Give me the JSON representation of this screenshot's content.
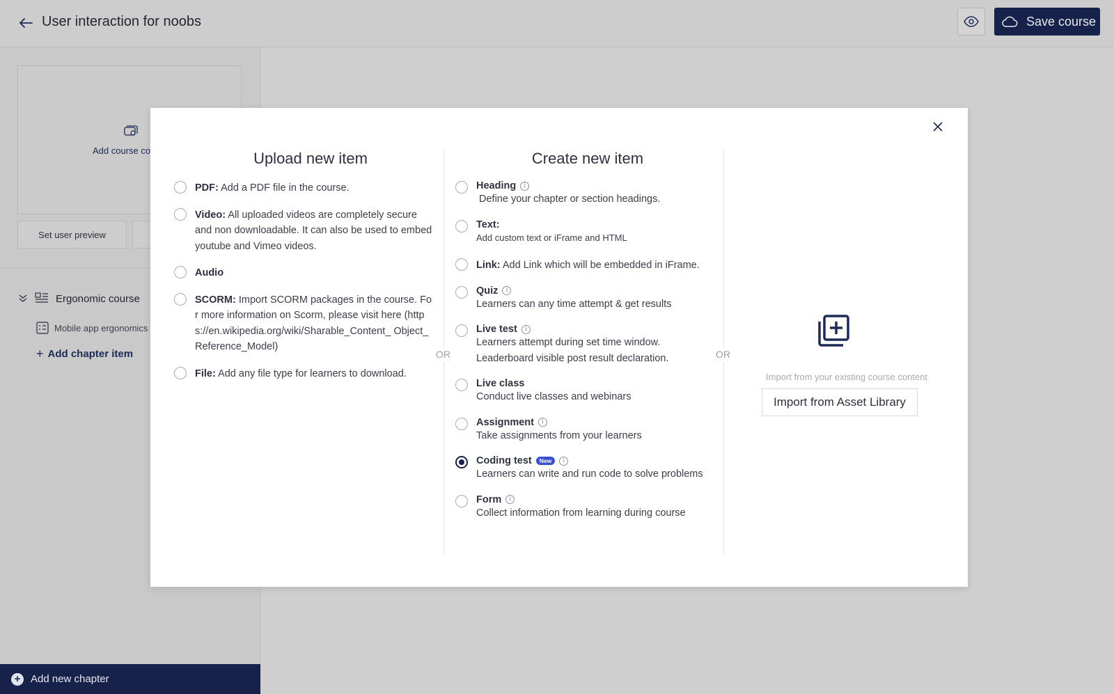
{
  "header": {
    "title": "User interaction for noobs",
    "save_label": "Save course",
    "icons": {
      "back": "arrow-left-icon",
      "preview": "eye-icon",
      "save": "cloud-icon"
    }
  },
  "sidebar": {
    "cover_label": "Add course co",
    "set_user_preview": "Set user preview",
    "chapter_title": "Ergonomic course",
    "chapter_item_label": "Mobile app ergonomics",
    "add_chapter_item": "Add chapter item",
    "add_new_chapter": "Add new chapter"
  },
  "modal": {
    "upload": {
      "title": "Upload new item",
      "options": [
        {
          "name": "PDF:",
          "desc": "Add a PDF file in the course."
        },
        {
          "name": "Video:",
          "desc": "All uploaded videos are completely secure and non downloadable. It can also be used to embed youtube and Vimeo videos."
        },
        {
          "name": "Audio",
          "desc": ""
        },
        {
          "name": "SCORM:",
          "desc": "Import SCORM packages in the course. For more information on Scorm, please visit here (https://en.wikipedia.org/wiki/Sharable_Content_ Object_Reference_Model)"
        },
        {
          "name": "File:",
          "desc": "Add any file type for learners to download."
        }
      ]
    },
    "or_label": "OR",
    "create": {
      "title": "Create new item",
      "options": [
        {
          "name": "Heading",
          "desc": "Define your chapter or section headings."
        },
        {
          "name": "Text:",
          "desc": "Add custom text or iFrame and HTML"
        },
        {
          "name": "Link:",
          "desc": "Add Link which will be embedded in iFrame."
        },
        {
          "name": "Quiz",
          "desc": "Learners can any time attempt & get results"
        },
        {
          "name": "Live test",
          "desc": "Learners attempt during set time window. Leaderboard visible post result declaration."
        },
        {
          "name": "Live class",
          "desc": "Conduct live classes and webinars"
        },
        {
          "name": "Assignment",
          "desc": "Take assignments from your learners"
        },
        {
          "name": "Coding test",
          "badge": "New",
          "desc": "Learners can write and run code to solve problems",
          "selected": true
        },
        {
          "name": "Form",
          "desc": "Collect information from learning during course"
        }
      ]
    },
    "import": {
      "caption": "Import from your existing course content",
      "button": "Import from Asset Library"
    }
  },
  "colors": {
    "navy": "#17224a",
    "badge": "#3a4fd1",
    "overlay": "#cfcfcf"
  }
}
